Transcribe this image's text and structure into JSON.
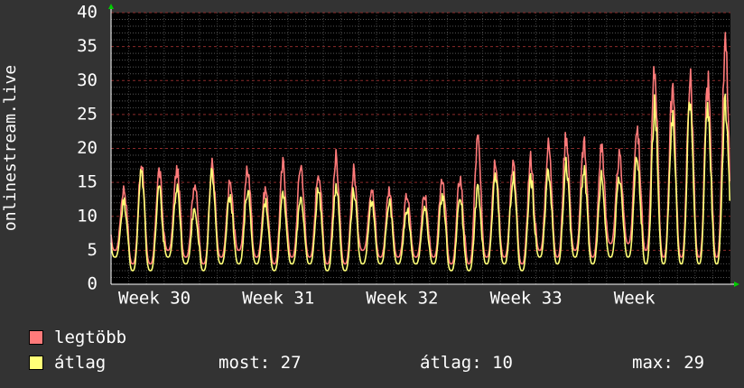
{
  "chart_data": {
    "type": "line",
    "ylabel": "onlinestream.live",
    "xlabel": "",
    "title": "",
    "ylim": [
      0,
      40
    ],
    "yticks": [
      "0",
      "5",
      "10",
      "15",
      "20",
      "25",
      "30",
      "35",
      "40"
    ],
    "xticks": [
      "Week 30",
      "Week 31",
      "Week 32",
      "Week 33",
      "Week"
    ],
    "xrange_days": 35,
    "grid": true,
    "series": [
      {
        "name": "legtöbb",
        "color": "#ff7a7a",
        "daily_peaks": [
          15,
          19,
          18,
          18,
          16,
          19,
          16,
          18,
          15,
          19,
          19,
          18,
          20,
          18,
          15,
          15,
          14,
          14,
          17,
          17,
          23,
          20,
          19,
          20,
          22,
          24,
          22,
          22,
          20,
          25,
          34,
          31,
          33,
          32,
          38
        ],
        "daily_lows": [
          5,
          3,
          3,
          5,
          4,
          3,
          4,
          5,
          4,
          3,
          4,
          4,
          3,
          3,
          5,
          4,
          4,
          4,
          4,
          3,
          3,
          4,
          4,
          3,
          5,
          4,
          5,
          4,
          6,
          6,
          5,
          4,
          4,
          4,
          4
        ]
      },
      {
        "name": "átlag",
        "color": "#ffff77",
        "daily_peaks": [
          13,
          18,
          15,
          15,
          12,
          18,
          14,
          15,
          13,
          15,
          14,
          15,
          16,
          15,
          13,
          13,
          12,
          12,
          14,
          14,
          15,
          17,
          17,
          17,
          18,
          19,
          18,
          17,
          17,
          20,
          28,
          27,
          29,
          28,
          29
        ],
        "daily_lows": [
          4,
          2,
          2,
          4,
          3,
          2,
          3,
          3,
          3,
          2,
          3,
          3,
          2,
          2,
          3,
          3,
          3,
          3,
          3,
          2,
          2,
          3,
          3,
          2,
          4,
          3,
          4,
          3,
          4,
          4,
          3,
          3,
          3,
          3,
          3
        ]
      }
    ]
  },
  "legend": {
    "max_label": "legtöbb",
    "avg_label": "átlag",
    "max_color": "#ff7a7a",
    "avg_color": "#ffff77",
    "most": "most: 27",
    "atlag": "átlag: 10",
    "max": "max: 29"
  }
}
